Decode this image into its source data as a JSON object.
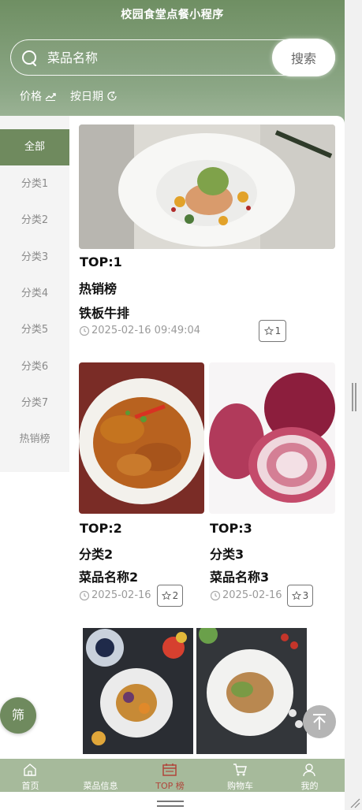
{
  "app": {
    "title": "校园食堂点餐小程序"
  },
  "search": {
    "placeholder": "菜品名称",
    "button_label": "搜索"
  },
  "sort": {
    "price_label": "价格",
    "date_label": "按日期"
  },
  "categories": [
    {
      "label": "全部",
      "active": true
    },
    {
      "label": "分类1"
    },
    {
      "label": "分类2"
    },
    {
      "label": "分类3"
    },
    {
      "label": "分类4"
    },
    {
      "label": "分类5"
    },
    {
      "label": "分类6"
    },
    {
      "label": "分类7"
    },
    {
      "label": "热销榜"
    }
  ],
  "items": [
    {
      "rank": "TOP:1",
      "category": "热销榜",
      "name": "铁板牛排",
      "date": "2025-02-16 09:49:04",
      "favorites": "1"
    },
    {
      "rank": "TOP:2",
      "category": "分类2",
      "name": "菜品名称2",
      "date": "2025-02-16",
      "favorites": "2"
    },
    {
      "rank": "TOP:3",
      "category": "分类3",
      "name": "菜品名称3",
      "date": "2025-02-16",
      "favorites": "3"
    }
  ],
  "filter_button": "筛",
  "tabbar": [
    {
      "label": "首页",
      "icon": "home-icon"
    },
    {
      "label": "菜品信息",
      "icon": "dish-icon"
    },
    {
      "label": "TOP 榜",
      "icon": "calendar-icon",
      "active": true
    },
    {
      "label": "购物车",
      "icon": "cart-icon"
    },
    {
      "label": "我的",
      "icon": "user-icon"
    }
  ],
  "colors": {
    "brand": "#6f8a5e",
    "active_tab": "#b0453b"
  }
}
